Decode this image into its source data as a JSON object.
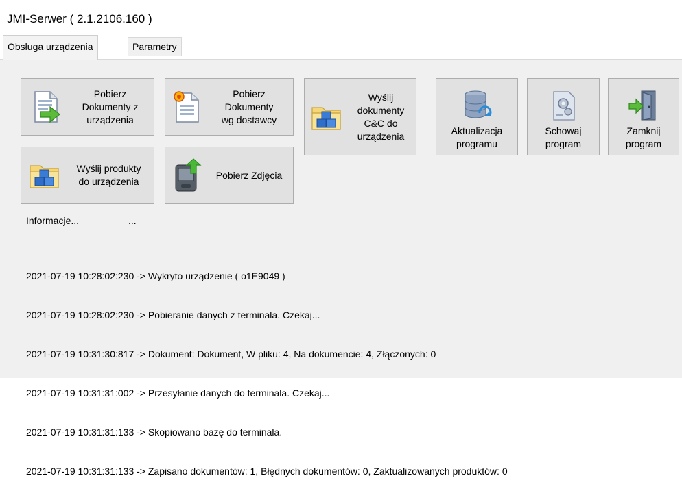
{
  "window": {
    "title": "JMI-Serwer ( 2.1.2106.160 )"
  },
  "tabs": [
    {
      "label": "Obsługa urządzenia",
      "active": true
    },
    {
      "label": "Parametry",
      "active": false
    }
  ],
  "buttons": {
    "get_docs": {
      "label": "Pobierz\nDokumenty z\nurządzenia",
      "icon": "document-import-icon"
    },
    "get_docs_supplier": {
      "label": "Pobierz\nDokumenty\nwg dostawcy",
      "icon": "document-new-icon"
    },
    "send_cc_docs": {
      "label": "Wyślij\ndokumenty\nC&C do\nurządzenia",
      "icon": "folder-boxes-icon"
    },
    "update": {
      "label": "Aktualizacja\nprogramu",
      "icon": "database-refresh-icon"
    },
    "hide": {
      "label": "Schowaj\nprogram",
      "icon": "settings-document-icon"
    },
    "close": {
      "label": "Zamknij\nprogram",
      "icon": "door-exit-icon"
    },
    "send_products": {
      "label": "Wyślij produkty\ndo urządzenia",
      "icon": "folder-boxes-icon"
    },
    "get_photos": {
      "label": "Pobierz Zdjęcia",
      "icon": "device-upload-icon"
    }
  },
  "info": {
    "label": "Informacje...",
    "value": "..."
  },
  "log": [
    "2021-07-19 10:28:02:230 -> Wykryto urządzenie ( o1E9049 )",
    "2021-07-19 10:28:02:230 -> Pobieranie danych z terminala. Czekaj...",
    "2021-07-19 10:31:30:817 -> Dokument: Dokument, W pliku: 4, Na dokumencie: 4, Złączonych: 0",
    "2021-07-19 10:31:31:002 -> Przesyłanie danych do terminala. Czekaj...",
    "2021-07-19 10:31:31:133 -> Skopiowano bazę do terminala.",
    "2021-07-19 10:31:31:133 -> Zapisano dokumentów: 1, Błędnych dokumentów: 0, Zaktualizowanych produktów: 0"
  ]
}
